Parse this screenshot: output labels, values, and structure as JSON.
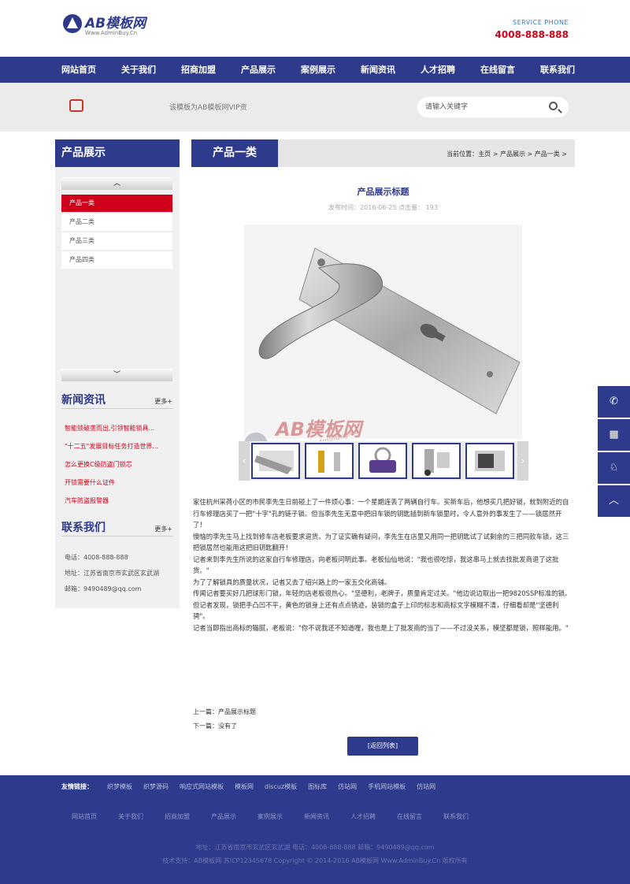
{
  "header": {
    "logo_text": "AB模板网",
    "logo_sub": "Www.AdminBuy.Cn",
    "phone_label": "SERVICE PHONE",
    "phone_number": "4008-888-888"
  },
  "nav": [
    "网站首页",
    "关于我们",
    "招商加盟",
    "产品展示",
    "案例展示",
    "新闻资讯",
    "人才招聘",
    "在线留言",
    "联系我们"
  ],
  "notice": "该模板为AB模板网VIP资",
  "search": {
    "placeholder": "请输入关键字"
  },
  "sidebar": {
    "title": "产品展示",
    "up_arrow": "︿",
    "down_arrow": "﹀",
    "categories": [
      "产品一类",
      "产品二类",
      "产品三类",
      "产品四类"
    ],
    "news_title": "新闻资讯",
    "news_more": "更多+",
    "news": [
      "智能锁破垄而出,引领智能锁具...",
      "\"十二五\"发展目标任务打造世界...",
      "怎么更换C级防盗门锁芯",
      "开锁需要什么证件",
      "汽车防盗报警器"
    ],
    "contact_title": "联系我们",
    "contact_more": "更多+",
    "contact": [
      "电话：4008-888-888",
      "地址：江苏省南京市玄武区玄武湖",
      "邮箱：9490489@qq.com"
    ]
  },
  "main": {
    "category": "产品一类",
    "breadcrumb": "当前位置：主页 > 产品展示 > 产品一类 >",
    "title": "产品展示标题",
    "meta": "发布时间：2016-06-25    点击量：  193",
    "watermark_text": "AB模板网",
    "watermark_sub": "Www.AdminBuy.Cn",
    "thumb_prev": "‹",
    "thumb_next": "›",
    "article": [
      "家住杭州采荷小区的市民李先生日前碰上了一件烦心事：一个星期连丢了两辆自行车。买新车后，他想买几把好锁，就到附近的自行车修理店买了一把\"十字\"孔的链子锁。但当李先生无意中把旧车锁的钥匙插到新车锁里时，令人意外的事发生了——锁居然开了！",
      "懊恼的李先生马上找到修车店老板要求退货。为了证实确有疑问，李先生在店里又用同一把钥匙试了试剩余的三把同款车锁，这三把锁居然也能用这把旧钥匙翻开！",
      "记者来到李先生所说的这家自行车修理店，向老板问明此事。老板仙仙地说：\"我也很吃惊，我这串马上就去找批发商退了这批货。\"",
      "为了了解锁具的质量状况，记者又去了绍兴路上的一家五交化商铺。",
      "传闻记者要买好几把球形门锁，年轻的店老板很热心。\"坚德利，老牌子，质量肯定过关。\"他边说边取出一把9820SSP标准的锁。但记者发现，锁把手凸凹不平，黄色的锁身上还有点点锈迹，装锁的盒子上印的标志和商标文字模糊不清，仔细看却是\"坚德利骋\"。",
      "记者当即指出商标的猫腻，老板说：\"你不说我还不知道哩，我也是上了批发商的当了——不过没关系，模坚都是锁，照样能用。\""
    ],
    "prev": "上一篇：产品展示标题",
    "next": "下一篇：没有了",
    "back_button": "[返回列表]"
  },
  "links": {
    "label": "友情链接：",
    "items": [
      "织梦模板",
      "织梦源码",
      "响应式网站模板",
      "模板网",
      "discuz模板",
      "图标库",
      "仿站网",
      "手机网站模板",
      "仿站网"
    ]
  },
  "footer": {
    "nav": [
      "网站首页",
      "关于我们",
      "招商加盟",
      "产品展示",
      "案例展示",
      "新闻资讯",
      "人才招聘",
      "在线留言",
      "联系我们"
    ],
    "address": "地址：江苏省南京市玄武区玄武湖    电话：4008-888-888    邮箱：9490489@qq.com",
    "copyright": "技术支持：AB模板网    苏ICP12345678    Copyright © 2014-2016 AB模板网 Www.AdminBuy.Cn 版权所有"
  },
  "float": {
    "icons": [
      "phone-icon",
      "qrcode-icon",
      "qq-icon",
      "back-to-top-icon"
    ],
    "glyphs": [
      "✆",
      "▦",
      "♘",
      "︿"
    ]
  },
  "colors": {
    "brand": "#2e3a8c",
    "accent": "#d0021b"
  }
}
